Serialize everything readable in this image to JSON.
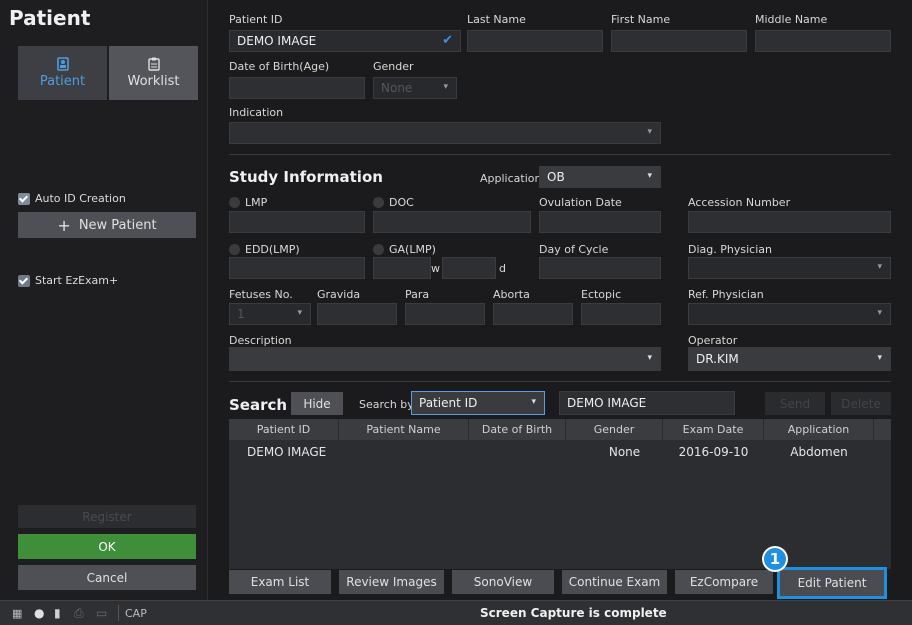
{
  "sidebar": {
    "title": "Patient",
    "tabs": [
      {
        "label": "Patient",
        "icon": "patient-icon"
      },
      {
        "label": "Worklist",
        "icon": "worklist-icon"
      }
    ],
    "auto_id_label": "Auto ID Creation",
    "new_patient_label": "New Patient",
    "start_ezexam_label": "Start EzExam+",
    "register_label": "Register",
    "ok_label": "OK",
    "cancel_label": "Cancel"
  },
  "patient": {
    "id_label": "Patient ID",
    "id_value": "DEMO IMAGE",
    "last_name_label": "Last Name",
    "first_name_label": "First Name",
    "middle_name_label": "Middle Name",
    "dob_label": "Date of Birth(Age)",
    "gender_label": "Gender",
    "gender_value": "None",
    "indication_label": "Indication"
  },
  "study": {
    "title": "Study Information",
    "application_label": "Application",
    "application_value": "OB",
    "lmp_label": "LMP",
    "doc_label": "DOC",
    "ovulation_label": "Ovulation Date",
    "accession_label": "Accession Number",
    "edd_label": "EDD(LMP)",
    "ga_label": "GA(LMP)",
    "w_unit": "w",
    "d_unit": "d",
    "cycle_label": "Day of Cycle",
    "diag_label": "Diag. Physician",
    "fetuses_label": "Fetuses No.",
    "fetuses_value": "1",
    "gravida_label": "Gravida",
    "para_label": "Para",
    "aborta_label": "Aborta",
    "ectopic_label": "Ectopic",
    "ref_label": "Ref. Physician",
    "description_label": "Description",
    "operator_label": "Operator",
    "operator_value": "DR.KIM"
  },
  "search": {
    "title": "Search",
    "hide_label": "Hide",
    "search_by_label": "Search by",
    "search_by_value": "Patient ID",
    "query_value": "DEMO IMAGE",
    "send_label": "Send",
    "delete_label": "Delete",
    "columns": [
      "Patient ID",
      "Patient Name",
      "Date of Birth",
      "Gender",
      "Exam Date",
      "Application"
    ],
    "rows": [
      {
        "id": "DEMO IMAGE",
        "name": "",
        "dob": "",
        "gender": "None",
        "exam_date": "2016-09-10",
        "application": "Abdomen"
      }
    ]
  },
  "bottom_buttons": [
    "Exam List",
    "Review Images",
    "SonoView",
    "Continue Exam",
    "EzCompare",
    "Edit Patient"
  ],
  "callout_number": "1",
  "status": {
    "cap_label": "CAP",
    "message": "Screen Capture is complete"
  },
  "colors": {
    "accent_blue": "#1f8fe0",
    "ok_green": "#3f8f3a",
    "active_tab_text": "#4e9ce0"
  }
}
